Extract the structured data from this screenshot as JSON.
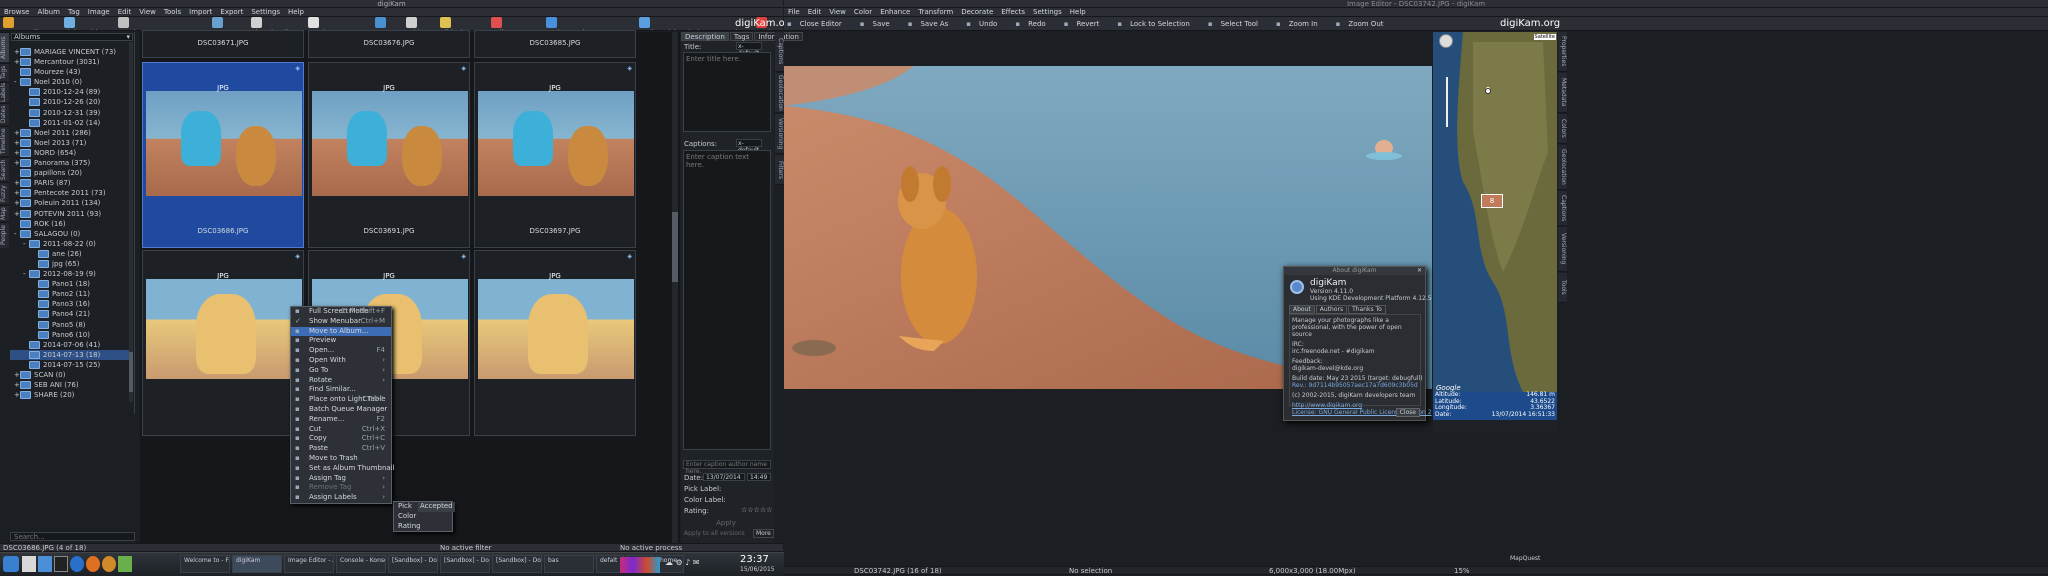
{
  "left_window": {
    "title": "digiKam",
    "menu": [
      "Browse",
      "Album",
      "Tag",
      "Image",
      "Edit",
      "View",
      "Tools",
      "Import",
      "Export",
      "Settings",
      "Help"
    ],
    "toolbar": [
      "Image Editor",
      "Light Table",
      "Batch Queue Manager",
      "Import",
      "Thumbnails",
      "Preview Image",
      "Map",
      "Table",
      "Slideshow",
      "Full Screen",
      "Assign Rating \"3 Star\"",
      "Assign Pick Label \"Accepted\"",
      "Assign Color Label \"Red\""
    ],
    "brand": "digiKam.org",
    "albums_combo": "Albums",
    "sidebar_tabs": [
      "Albums",
      "Tags",
      "Labels",
      "Dates",
      "Timeline",
      "Search",
      "Fuzzy",
      "Map",
      "People"
    ],
    "albums": [
      {
        "label": "MARIAGE VINCENT (73)",
        "depth": 0,
        "exp": "+"
      },
      {
        "label": "Mercantour (3031)",
        "depth": 0,
        "exp": "+"
      },
      {
        "label": "Moureze (43)",
        "depth": 0,
        "exp": ""
      },
      {
        "label": "Noel 2010 (0)",
        "depth": 0,
        "exp": "-"
      },
      {
        "label": "2010-12-24 (89)",
        "depth": 1,
        "exp": ""
      },
      {
        "label": "2010-12-26 (20)",
        "depth": 1,
        "exp": ""
      },
      {
        "label": "2010-12-31 (39)",
        "depth": 1,
        "exp": ""
      },
      {
        "label": "2011-01-02 (14)",
        "depth": 1,
        "exp": ""
      },
      {
        "label": "Noel 2011 (286)",
        "depth": 0,
        "exp": "+"
      },
      {
        "label": "Noel 2013 (71)",
        "depth": 0,
        "exp": "+"
      },
      {
        "label": "NORD (654)",
        "depth": 0,
        "exp": "+"
      },
      {
        "label": "Panorama (375)",
        "depth": 0,
        "exp": "+"
      },
      {
        "label": "papillons (20)",
        "depth": 0,
        "exp": ""
      },
      {
        "label": "PARIS (87)",
        "depth": 0,
        "exp": "+"
      },
      {
        "label": "Pentecote 2011 (73)",
        "depth": 0,
        "exp": "+"
      },
      {
        "label": "Poleuin 2011 (134)",
        "depth": 0,
        "exp": "+"
      },
      {
        "label": "POTEVIN 2011 (93)",
        "depth": 0,
        "exp": "+"
      },
      {
        "label": "ROK (16)",
        "depth": 0,
        "exp": ""
      },
      {
        "label": "SALAGOU (0)",
        "depth": 0,
        "exp": "-"
      },
      {
        "label": "2011-08-22 (0)",
        "depth": 1,
        "exp": "-"
      },
      {
        "label": "ane (26)",
        "depth": 2,
        "exp": ""
      },
      {
        "label": "jpg (65)",
        "depth": 2,
        "exp": ""
      },
      {
        "label": "2012-08-19 (9)",
        "depth": 1,
        "exp": "-"
      },
      {
        "label": "Pano1 (18)",
        "depth": 2,
        "exp": ""
      },
      {
        "label": "Pano2 (11)",
        "depth": 2,
        "exp": ""
      },
      {
        "label": "Pano3 (16)",
        "depth": 2,
        "exp": ""
      },
      {
        "label": "Pano4 (21)",
        "depth": 2,
        "exp": ""
      },
      {
        "label": "Pano5 (8)",
        "depth": 2,
        "exp": ""
      },
      {
        "label": "Pano6 (10)",
        "depth": 2,
        "exp": ""
      },
      {
        "label": "2014-07-06 (41)",
        "depth": 1,
        "exp": ""
      },
      {
        "label": "2014-07-13 (18)",
        "depth": 1,
        "exp": "",
        "sel": true
      },
      {
        "label": "2014-07-15 (25)",
        "depth": 1,
        "exp": ""
      },
      {
        "label": "SCAN (0)",
        "depth": 0,
        "exp": "+"
      },
      {
        "label": "SEB ANI (76)",
        "depth": 0,
        "exp": "+"
      },
      {
        "label": "SHARE (20)",
        "depth": 0,
        "exp": "+"
      }
    ],
    "search_placeholder": "Search...",
    "thumbs": [
      "DSC03671.JPG",
      "DSC03676.JPG",
      "DSC03685.JPG",
      "DSC03686.JPG",
      "DSC03691.JPG",
      "DSC03697.JPG",
      "",
      "",
      ""
    ],
    "jpg_badge": "JPG",
    "context_menu": [
      {
        "label": "Full Screen Mode",
        "sc": "Ctrl+Shift+F"
      },
      {
        "label": "Show Menubar",
        "sc": "Ctrl+M",
        "chk": true
      },
      {
        "label": "Move to Album...",
        "sc": "",
        "hl": true
      },
      {
        "label": "Preview",
        "sc": ""
      },
      {
        "label": "Open...",
        "sc": "F4"
      },
      {
        "label": "Open With",
        "sc": "›"
      },
      {
        "label": "Go To",
        "sc": "›"
      },
      {
        "label": "Rotate",
        "sc": "›"
      },
      {
        "label": "Find Similar...",
        "sc": ""
      },
      {
        "label": "Place onto Light Table",
        "sc": "Ctrl+L"
      },
      {
        "label": "Batch Queue Manager",
        "sc": "›"
      },
      {
        "label": "Rename...",
        "sc": "F2"
      },
      {
        "label": "Cut",
        "sc": "Ctrl+X"
      },
      {
        "label": "Copy",
        "sc": "Ctrl+C"
      },
      {
        "label": "Paste",
        "sc": "Ctrl+V"
      },
      {
        "label": "Move to Trash",
        "sc": ""
      },
      {
        "label": "Set as Album Thumbnail",
        "sc": ""
      },
      {
        "label": "Assign Tag",
        "sc": "›"
      },
      {
        "label": "Remove Tag",
        "sc": "›",
        "dis": true
      },
      {
        "label": "Assign Labels",
        "sc": "›"
      }
    ],
    "submenu": [
      "Pick",
      "Color",
      "Rating"
    ],
    "submenu_value": "Accepted",
    "right_tabs": [
      "Description",
      "Tags",
      "Information"
    ],
    "title_label": "Title:",
    "title_placeholder": "Enter title here.",
    "title_combo": "x-default",
    "captions_label": "Captions:",
    "captions_combo": "x-default",
    "caption_placeholder": "Enter caption text here.",
    "author_placeholder": "Enter caption author name here.",
    "date_label": "Date:",
    "date_value": "13/07/2014",
    "time_value": "14:49",
    "pick_label": "Pick Label:",
    "color_label": "Color Label:",
    "rating_label": "Rating:",
    "apply_label": "Apply",
    "apply_all": "Apply to all versions",
    "more_label": "More",
    "status_file": "DSC03686.JPG (4 of 18)",
    "status_filter": "No active filter",
    "status_process": "No active process",
    "right_sidetabs": [
      "Captions",
      "Geolocation",
      "Versioning",
      "Filters"
    ]
  },
  "right_window": {
    "title": "Image Editor - DSC03742.JPG - digiKam",
    "menu": [
      "File",
      "Edit",
      "View",
      "Color",
      "Enhance",
      "Transform",
      "Decorate",
      "Effects",
      "Settings",
      "Help"
    ],
    "toolbar": [
      "Close Editor",
      "Save",
      "Save As",
      "Undo",
      "Redo",
      "Revert",
      "Lock to Selection",
      "Select Tool",
      "Zoom In",
      "Zoom Out"
    ],
    "brand": "digiKam.org",
    "about": {
      "title": "About digiKam",
      "app": "digiKam",
      "version": "Version 4.11.0",
      "platform": "Using KDE Development Platform 4.12.5",
      "tabs": [
        "About",
        "Authors",
        "Thanks To"
      ],
      "desc": "Manage your photographs like a professional, with the power of open source",
      "irc_label": "IRC:",
      "irc": "irc.freenode.net - #digikam",
      "fb_label": "Feedback:",
      "fb": "digikam-devel@kde.org",
      "build": "Build date: May 23 2015 (target: debugfull)",
      "rev": "Rev.: 9d7114b95057aec17a7d609c3b05d65c6a4e8f44",
      "copyright": "(c) 2002-2015, digiKam developers team",
      "url": "http://www.digikam.org",
      "license": "License: GNU General Public License Version 2",
      "close": "Close"
    },
    "map": {
      "altitude_label": "Altitude:",
      "altitude": "146.81 m",
      "latitude_label": "Latitude:",
      "latitude": "43.6522",
      "longitude_label": "Longitude:",
      "longitude": "3.36367",
      "date_label": "Date:",
      "date": "13/07/2014 16:51:33",
      "provider": "MapQuest",
      "logo": "Google",
      "tag1": "Sat",
      "tag2": "Satellite",
      "thumb_count": "8"
    },
    "status_file": "DSC03742.JPG (16 of 18)",
    "status_sel": "No selection",
    "status_size": "6,000x3,000 (18.00Mpx)",
    "zoom": "15%",
    "right_sidetabs": [
      "Properties",
      "Metadata",
      "Colors",
      "Geolocation",
      "Captions",
      "Versioning",
      "Tools"
    ]
  },
  "taskbar": {
    "tasks": [
      "Welcome to - Firefox ... Photo: EU",
      "digiKam",
      "Image Editor - Album: 2014-0...",
      "Console - Konsole",
      "[Sandbox] - Dol...",
      "[Sandbox] - Dol...",
      "[Sandbox] - Dol...",
      "bas",
      "defalt",
      "data",
      "home"
    ],
    "time": "23:37",
    "date": "15/06/2015"
  },
  "colors": {
    "selection": "#1f4aa0",
    "menu_hl": "#3d6db5",
    "sea": "#5f8eaa",
    "rock": "#b97758",
    "dog": "#d08a3a"
  }
}
